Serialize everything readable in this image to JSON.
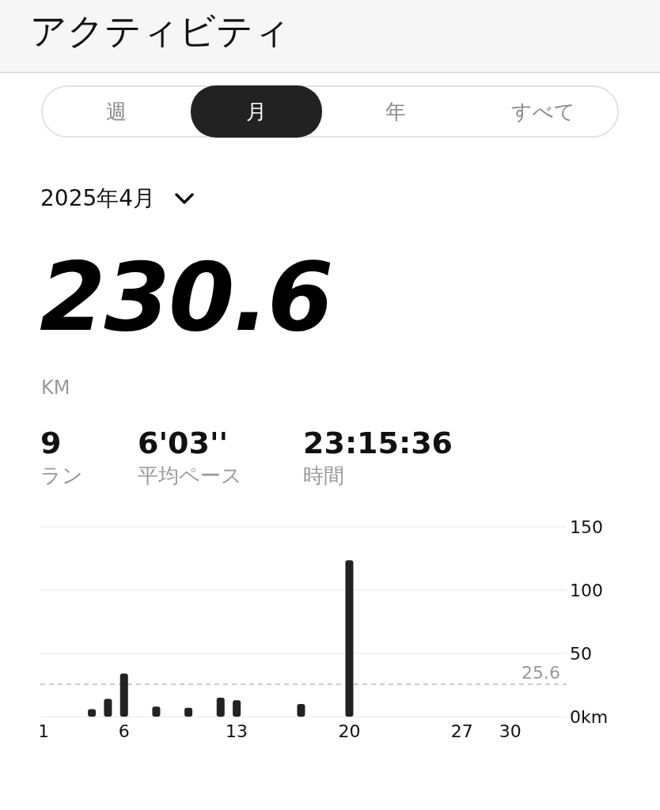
{
  "header": {
    "title": "アクティビティ"
  },
  "tabs": [
    {
      "label": "週",
      "selected": false
    },
    {
      "label": "月",
      "selected": true
    },
    {
      "label": "年",
      "selected": false
    },
    {
      "label": "すべて",
      "selected": false
    }
  ],
  "period": {
    "label": "2025年4月"
  },
  "total": {
    "value": "230.6",
    "unit": "KM"
  },
  "stats": [
    {
      "value": "9",
      "label": "ラン"
    },
    {
      "value": "6'03''",
      "label": "平均ペース"
    },
    {
      "value": "23:15:36",
      "label": "時間"
    }
  ],
  "chart_data": {
    "type": "bar",
    "x": [
      4,
      5,
      6,
      8,
      10,
      12,
      13,
      17,
      20
    ],
    "values": [
      6,
      14,
      34,
      8,
      7,
      15,
      13,
      10,
      123.6
    ],
    "xlim": [
      0.8,
      33.5
    ],
    "ylim": [
      0,
      150
    ],
    "xticks": [
      1,
      6,
      13,
      20,
      27,
      30
    ],
    "yticks": [
      {
        "value": 0,
        "label": "0km"
      },
      50,
      100,
      150
    ],
    "ref_lines": [
      {
        "axis": "y",
        "value": 25.6,
        "label": "25.6"
      }
    ]
  }
}
